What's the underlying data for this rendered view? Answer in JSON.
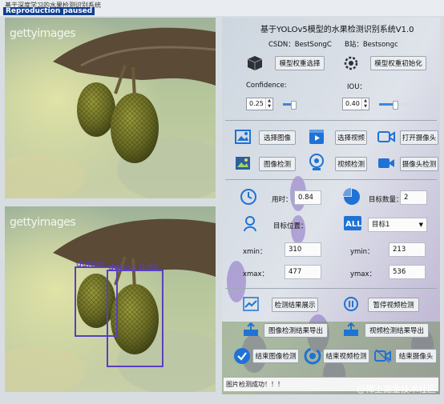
{
  "window": {
    "title": "基于深度学习的水果检测识别系统",
    "paused_badge": "Reproduction paused"
  },
  "left": {
    "top_watermark": "gettyimages",
    "bottom_watermark": "gettyimages",
    "detections": [
      {
        "label": "durian",
        "score": ""
      },
      {
        "label": "durian",
        "score": "0.88"
      }
    ],
    "box_color": "#5a3fc0"
  },
  "header": {
    "title": "基于YOLOv5模型的水果检测识别系统V1.0",
    "csdn": "CSDN：BestSongC",
    "bilibili": "B站：Bestsongc"
  },
  "model": {
    "select_label": "模型权重选择",
    "init_label": "模型权重初始化"
  },
  "params": {
    "confidence_label": "Confidence:",
    "iou_label": "IOU：",
    "confidence_value": "0.25",
    "iou_value": "0.40",
    "confidence_level": 0.25,
    "iou_level": 0.4
  },
  "actions": {
    "select_image": "选择图像",
    "select_video": "选择视频",
    "open_camera": "打开摄像头",
    "image_detect": "图像检测",
    "video_detect": "视频检测",
    "camera_detect": "摄像头检测"
  },
  "stats": {
    "time_label": "用时：",
    "time_value": "0.84",
    "count_label": "目标数量：",
    "count_value": "2",
    "position_label": "目标位置：",
    "target_select": "目标1",
    "xmin_label": "xmin：",
    "xmin_value": "310",
    "ymin_label": "ymin：",
    "ymin_value": "213",
    "xmax_label": "xmax：",
    "xmax_value": "477",
    "ymax_label": "ymax：",
    "ymax_value": "536"
  },
  "results": {
    "show_results": "检测结果展示",
    "pause_video": "暂停视频检测",
    "export_image": "图像检测结果导出",
    "export_video": "视频检测结果导出",
    "end_image": "结束图像检测",
    "end_video": "结束视频检测",
    "end_camera": "结束摄像头"
  },
  "status": {
    "message": "图片检测成功！！！"
  },
  "footer": {
    "watermark": "@稀土掘金技术社区"
  },
  "colors": {
    "accent": "#2f80d8",
    "icon_blue": "#1f72d6"
  }
}
